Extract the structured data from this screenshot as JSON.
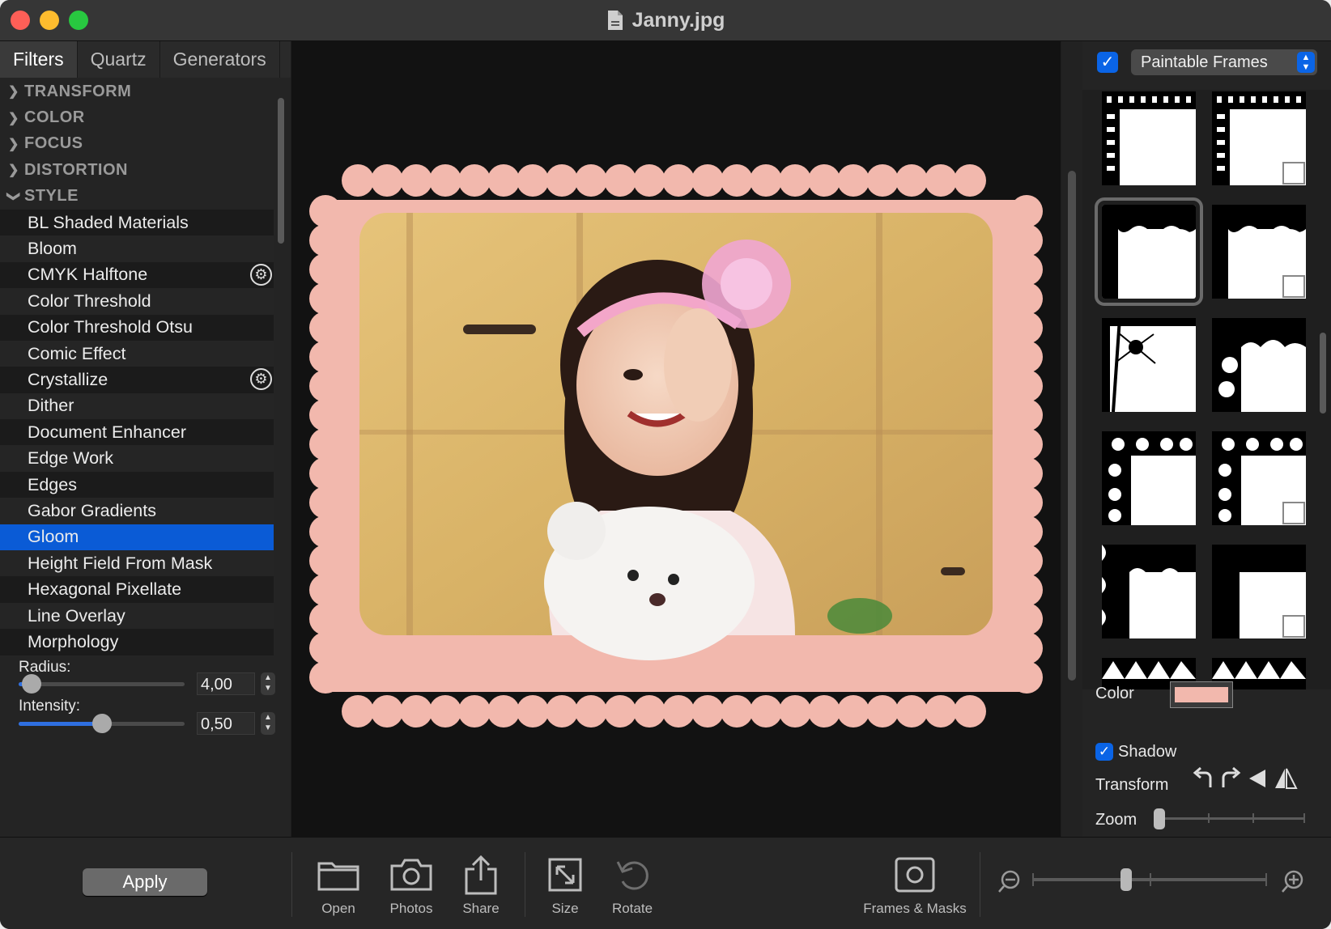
{
  "window": {
    "title": "Janny.jpg"
  },
  "left_panel": {
    "tabs": [
      {
        "label": "Filters",
        "active": true
      },
      {
        "label": "Quartz",
        "active": false
      },
      {
        "label": "Generators",
        "active": false
      }
    ],
    "categories": [
      {
        "label": "TRANSFORM",
        "expanded": false
      },
      {
        "label": "COLOR",
        "expanded": false
      },
      {
        "label": "FOCUS",
        "expanded": false
      },
      {
        "label": "DISTORTION",
        "expanded": false
      },
      {
        "label": "STYLE",
        "expanded": true
      }
    ],
    "style_filters": [
      {
        "label": "BL Shaded Materials",
        "has_settings": false,
        "selected": false
      },
      {
        "label": "Bloom",
        "has_settings": false,
        "selected": false
      },
      {
        "label": "CMYK Halftone",
        "has_settings": true,
        "selected": false
      },
      {
        "label": "Color Threshold",
        "has_settings": false,
        "selected": false
      },
      {
        "label": "Color Threshold Otsu",
        "has_settings": false,
        "selected": false
      },
      {
        "label": "Comic Effect",
        "has_settings": false,
        "selected": false
      },
      {
        "label": "Crystallize",
        "has_settings": true,
        "selected": false
      },
      {
        "label": "Dither",
        "has_settings": false,
        "selected": false
      },
      {
        "label": "Document Enhancer",
        "has_settings": false,
        "selected": false
      },
      {
        "label": "Edge Work",
        "has_settings": false,
        "selected": false
      },
      {
        "label": "Edges",
        "has_settings": false,
        "selected": false
      },
      {
        "label": "Gabor Gradients",
        "has_settings": false,
        "selected": false
      },
      {
        "label": "Gloom",
        "has_settings": false,
        "selected": true
      },
      {
        "label": "Height Field From Mask",
        "has_settings": false,
        "selected": false
      },
      {
        "label": "Hexagonal Pixellate",
        "has_settings": false,
        "selected": false
      },
      {
        "label": "Line Overlay",
        "has_settings": false,
        "selected": false
      },
      {
        "label": "Morphology",
        "has_settings": false,
        "selected": false
      }
    ],
    "params": {
      "radius": {
        "label": "Radius:",
        "value": "4,00",
        "level": 0.08
      },
      "intensity": {
        "label": "Intensity:",
        "value": "0,50",
        "level": 0.5
      }
    },
    "apply_label": "Apply"
  },
  "right_panel": {
    "enabled": true,
    "collection": "Paintable Frames",
    "color_label": "Color",
    "frame_color": "#f2b8ad",
    "shadow_label": "Shadow",
    "shadow_checked": true,
    "transform_label": "Transform",
    "zoom_label": "Zoom",
    "zoom_level": 0.0
  },
  "toolbar": {
    "open": "Open",
    "photos": "Photos",
    "share": "Share",
    "size": "Size",
    "rotate": "Rotate",
    "frames_masks": "Frames & Masks",
    "zoom_level": 0.4
  },
  "colors": {
    "accent": "#0a5bd6",
    "frame": "#f2b8ad"
  }
}
